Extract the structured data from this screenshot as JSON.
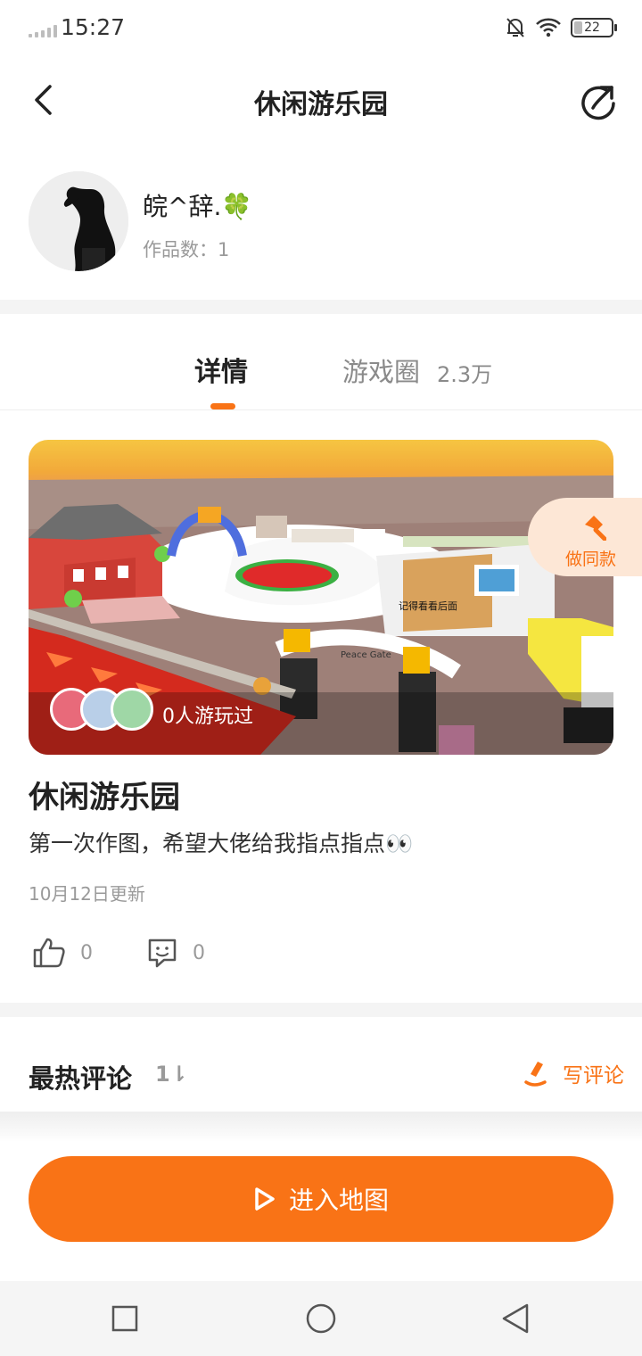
{
  "status_bar": {
    "time": "15:27",
    "battery": "22"
  },
  "header": {
    "title": "休闲游乐园"
  },
  "author": {
    "name": "皖^辞.🍀",
    "works_count": "作品数：1"
  },
  "tabs": {
    "detail": "详情",
    "circle": "游戏圈",
    "circle_count": "2.3万"
  },
  "cover": {
    "played_text": "0人游玩过",
    "sign_text": "Peace Gate",
    "booth_text": "记得看看后面"
  },
  "make_same": {
    "label": "做同款"
  },
  "game": {
    "title": "休闲游乐园",
    "description": "第一次作图，希望大佬给我指点指点👀",
    "updated": "10月12日更新",
    "likes": "0",
    "comments": "0"
  },
  "hot_comments": {
    "title": "最热评论",
    "sort_label": "1⇂",
    "write_label": "写评论"
  },
  "enter_map": {
    "label": "进入地图"
  },
  "colors": {
    "accent": "#f97316",
    "accent_light": "#fde7d6"
  }
}
